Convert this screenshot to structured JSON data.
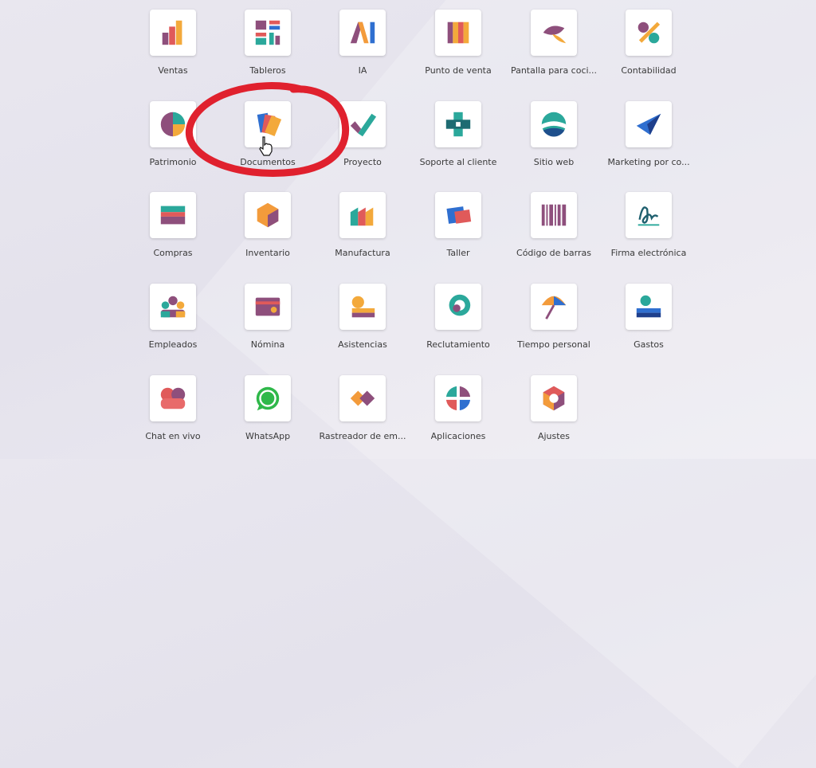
{
  "apps": [
    {
      "label": "Ventas",
      "icon": "ventas-icon"
    },
    {
      "label": "Tableros",
      "icon": "tableros-icon"
    },
    {
      "label": "IA",
      "icon": "ia-icon"
    },
    {
      "label": "Punto de venta",
      "icon": "punto-de-venta-icon"
    },
    {
      "label": "Pantalla para coci...",
      "icon": "pantalla-cocina-icon"
    },
    {
      "label": "Contabilidad",
      "icon": "contabilidad-icon"
    },
    {
      "label": "Patrimonio",
      "icon": "patrimonio-icon"
    },
    {
      "label": "Documentos",
      "icon": "documentos-icon"
    },
    {
      "label": "Proyecto",
      "icon": "proyecto-icon"
    },
    {
      "label": "Soporte al cliente",
      "icon": "soporte-icon"
    },
    {
      "label": "Sitio web",
      "icon": "sitio-web-icon"
    },
    {
      "label": "Marketing por co...",
      "icon": "marketing-icon"
    },
    {
      "label": "Compras",
      "icon": "compras-icon"
    },
    {
      "label": "Inventario",
      "icon": "inventario-icon"
    },
    {
      "label": "Manufactura",
      "icon": "manufactura-icon"
    },
    {
      "label": "Taller",
      "icon": "taller-icon"
    },
    {
      "label": "Código de barras",
      "icon": "codigo-barras-icon"
    },
    {
      "label": "Firma electrónica",
      "icon": "firma-icon"
    },
    {
      "label": "Empleados",
      "icon": "empleados-icon"
    },
    {
      "label": "Nómina",
      "icon": "nomina-icon"
    },
    {
      "label": "Asistencias",
      "icon": "asistencias-icon"
    },
    {
      "label": "Reclutamiento",
      "icon": "reclutamiento-icon"
    },
    {
      "label": "Tiempo personal",
      "icon": "tiempo-personal-icon"
    },
    {
      "label": "Gastos",
      "icon": "gastos-icon"
    },
    {
      "label": "Chat en vivo",
      "icon": "chat-icon"
    },
    {
      "label": "WhatsApp",
      "icon": "whatsapp-icon"
    },
    {
      "label": "Rastreador de em...",
      "icon": "rastreador-icon"
    },
    {
      "label": "Aplicaciones",
      "icon": "aplicaciones-icon"
    },
    {
      "label": "Ajustes",
      "icon": "ajustes-icon"
    }
  ],
  "colors": {
    "annotation": "#e0212e",
    "purple": "#8e4f7c",
    "orange": "#f39b3b",
    "teal": "#2ba89b",
    "blue": "#2f6fd0"
  }
}
